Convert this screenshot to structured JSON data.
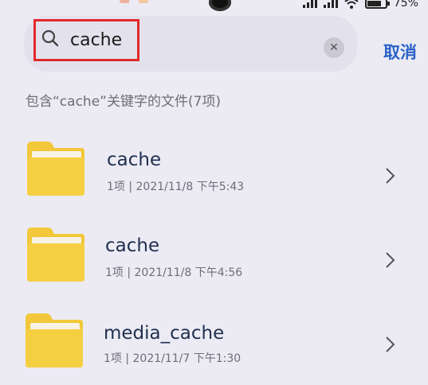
{
  "status_bar": {
    "battery_text": "75%"
  },
  "search": {
    "query": "cache",
    "placeholder": "",
    "cancel_label": "取消"
  },
  "results": {
    "summary": "包含“cache”关键字的文件(7项)",
    "items": [
      {
        "name": "cache",
        "meta": "1项  |  2021/11/8 下午5:43",
        "icon": "folder-icon"
      },
      {
        "name": "cache",
        "meta": "1项  |  2021/11/8 下午4:56",
        "icon": "folder-icon"
      },
      {
        "name": "media_cache",
        "meta": "1项  |  2021/11/7 下午1:30",
        "icon": "folder-icon"
      }
    ]
  },
  "colors": {
    "background": "#ecebf4",
    "accent": "#2a62c9",
    "folder": "#f2c83a",
    "highlight": "#e02a2a"
  }
}
